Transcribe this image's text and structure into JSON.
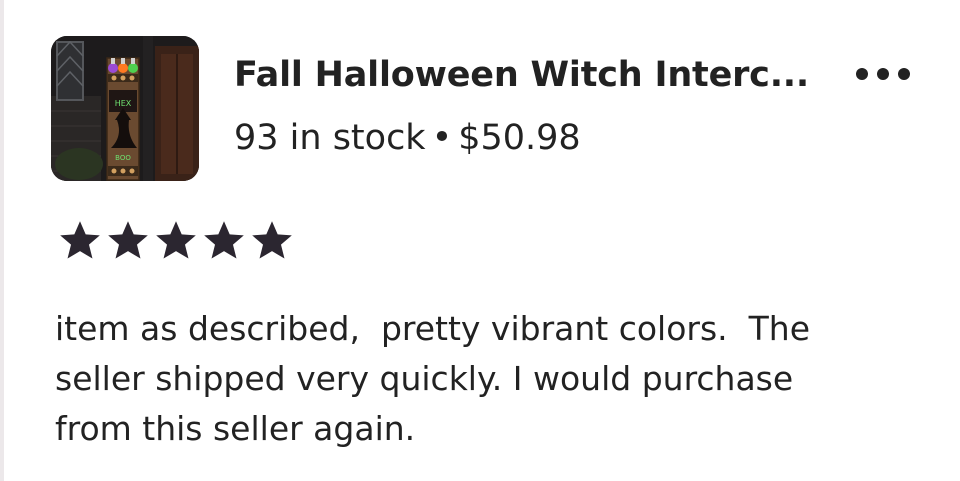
{
  "listing": {
    "title": "Fall Halloween Witch Interc...",
    "stock": "93 in stock",
    "separator": "•",
    "price": "$50.98",
    "thumbnail": "product-photo"
  },
  "actions": {
    "more_icon": "more-horizontal-icon"
  },
  "rating": {
    "stars": 5,
    "max": 5,
    "icon": "star-icon",
    "color": "#2b2630"
  },
  "review": {
    "text": "item as described,  pretty vibrant colors.  The\nseller shipped very quickly. I would purchase\nfrom this seller again."
  }
}
